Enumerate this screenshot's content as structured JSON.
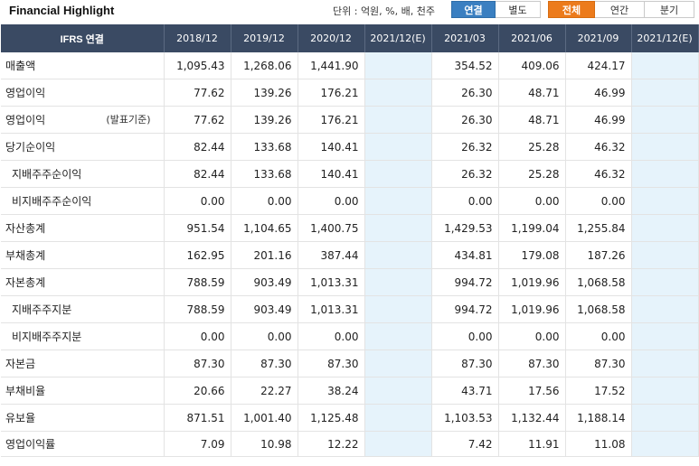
{
  "header": {
    "title": "Financial Highlight",
    "unit_label": "단위 : 억원, %, 배, 천주",
    "toggle_consolidation": [
      "연결",
      "별도"
    ],
    "toggle_period": [
      "전체",
      "연간",
      "분기"
    ]
  },
  "table": {
    "corner": "IFRS 연결",
    "columns": [
      "2018/12",
      "2019/12",
      "2020/12",
      "2021/12(E)",
      "2021/03",
      "2021/06",
      "2021/09",
      "2021/12(E)"
    ],
    "rows": [
      {
        "label": "매출액",
        "note": "",
        "values": [
          "1,095.43",
          "1,268.06",
          "1,441.90",
          "",
          "354.52",
          "409.06",
          "424.17",
          ""
        ]
      },
      {
        "label": "영업이익",
        "note": "",
        "values": [
          "77.62",
          "139.26",
          "176.21",
          "",
          "26.30",
          "48.71",
          "46.99",
          ""
        ]
      },
      {
        "label": "영업이익",
        "note": "(발표기준)",
        "values": [
          "77.62",
          "139.26",
          "176.21",
          "",
          "26.30",
          "48.71",
          "46.99",
          ""
        ]
      },
      {
        "label": "당기순이익",
        "note": "",
        "values": [
          "82.44",
          "133.68",
          "140.41",
          "",
          "26.32",
          "25.28",
          "46.32",
          ""
        ]
      },
      {
        "label": "지배주주순이익",
        "note": "",
        "values": [
          "82.44",
          "133.68",
          "140.41",
          "",
          "26.32",
          "25.28",
          "46.32",
          ""
        ]
      },
      {
        "label": "비지배주주순이익",
        "note": "",
        "values": [
          "0.00",
          "0.00",
          "0.00",
          "",
          "0.00",
          "0.00",
          "0.00",
          ""
        ]
      },
      {
        "label": "자산총계",
        "note": "",
        "values": [
          "951.54",
          "1,104.65",
          "1,400.75",
          "",
          "1,429.53",
          "1,199.04",
          "1,255.84",
          ""
        ]
      },
      {
        "label": "부채총계",
        "note": "",
        "values": [
          "162.95",
          "201.16",
          "387.44",
          "",
          "434.81",
          "179.08",
          "187.26",
          ""
        ]
      },
      {
        "label": "자본총계",
        "note": "",
        "values": [
          "788.59",
          "903.49",
          "1,013.31",
          "",
          "994.72",
          "1,019.96",
          "1,068.58",
          ""
        ]
      },
      {
        "label": "지배주주지분",
        "note": "",
        "values": [
          "788.59",
          "903.49",
          "1,013.31",
          "",
          "994.72",
          "1,019.96",
          "1,068.58",
          ""
        ]
      },
      {
        "label": "비지배주주지분",
        "note": "",
        "values": [
          "0.00",
          "0.00",
          "0.00",
          "",
          "0.00",
          "0.00",
          "0.00",
          ""
        ]
      },
      {
        "label": "자본금",
        "note": "",
        "values": [
          "87.30",
          "87.30",
          "87.30",
          "",
          "87.30",
          "87.30",
          "87.30",
          ""
        ]
      },
      {
        "label": "부채비율",
        "note": "",
        "values": [
          "20.66",
          "22.27",
          "38.24",
          "",
          "43.71",
          "17.56",
          "17.52",
          ""
        ]
      },
      {
        "label": "유보율",
        "note": "",
        "values": [
          "871.51",
          "1,001.40",
          "1,125.48",
          "",
          "1,103.53",
          "1,132.44",
          "1,188.14",
          ""
        ]
      },
      {
        "label": "영업이익률",
        "note": "",
        "values": [
          "7.09",
          "10.98",
          "12.22",
          "",
          "7.42",
          "11.91",
          "11.08",
          ""
        ]
      }
    ]
  },
  "colors": {
    "header_bg": "#3a4a63",
    "active_blue": "#3a7fc1",
    "active_orange": "#ec7b1c",
    "estimate_bg": "#e6f3fb"
  }
}
